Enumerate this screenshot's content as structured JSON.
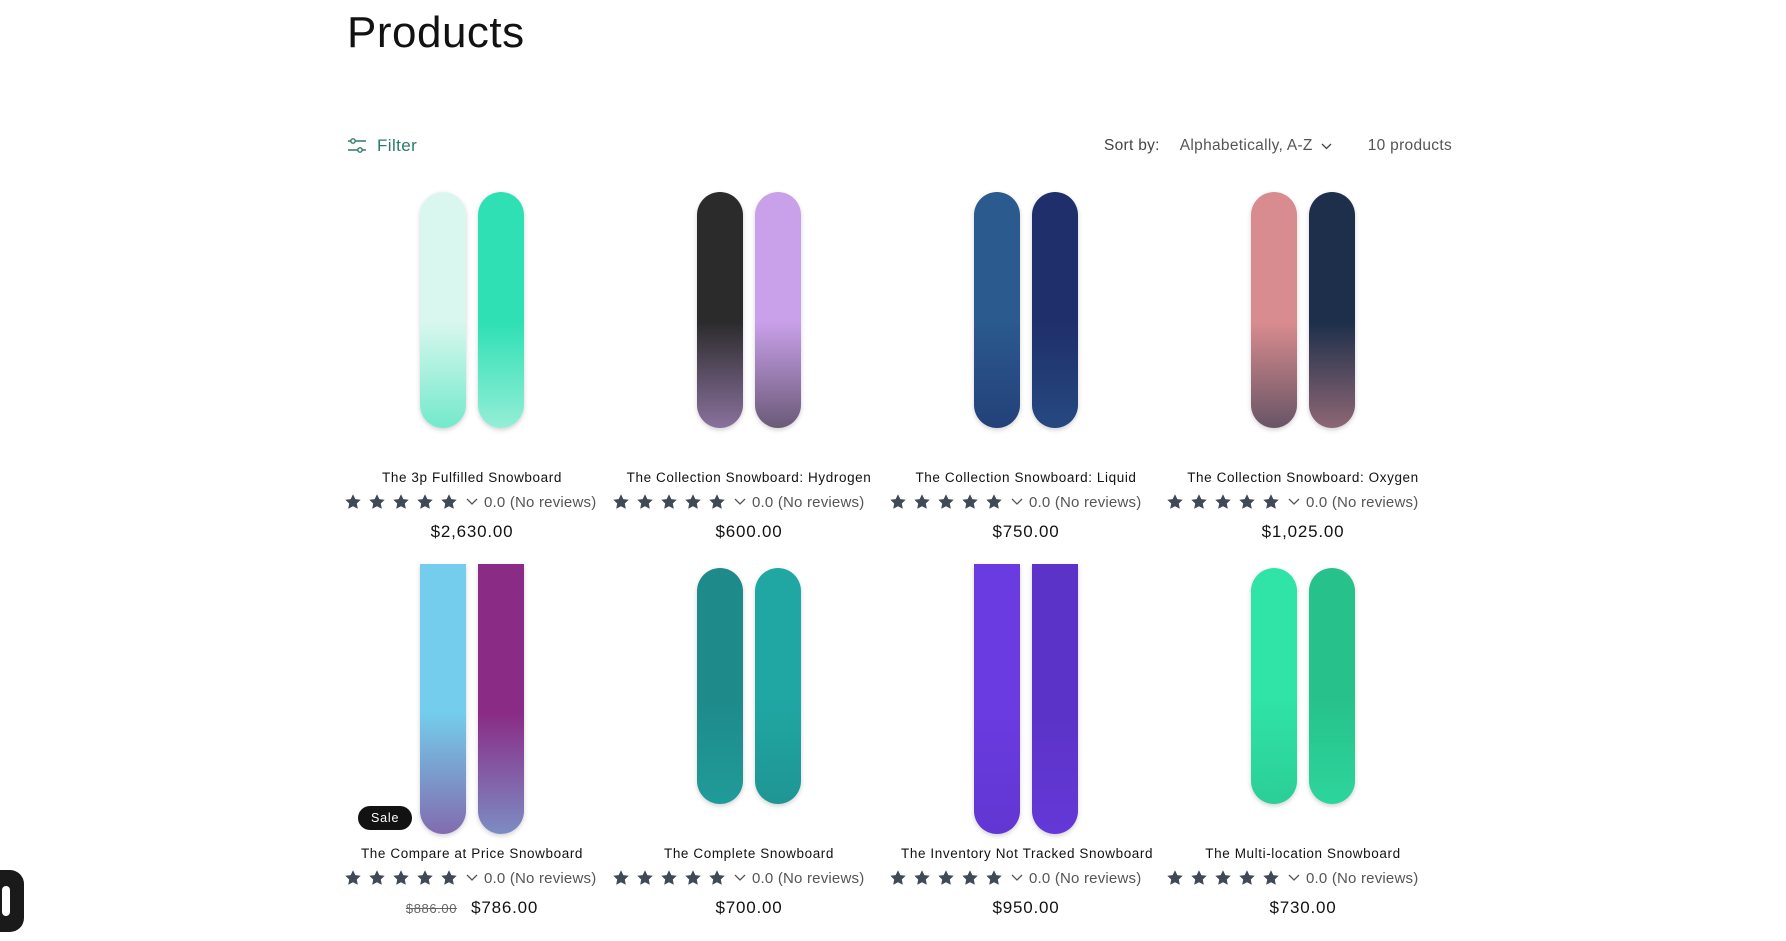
{
  "page": {
    "title": "Products"
  },
  "toolbar": {
    "filter_label": "Filter",
    "sort_label": "Sort by:",
    "sort_value": "Alphabetically, A-Z",
    "product_count": "10 products"
  },
  "products": [
    {
      "title": "The 3p Fulfilled Snowboard",
      "rating": "0.0 (No reviews)",
      "price": "$2,630.00",
      "compare_price": "",
      "badge": "",
      "colors": [
        "#d9f7ee",
        "#2ee0b4"
      ]
    },
    {
      "title": "The Collection Snowboard: Hydrogen",
      "rating": "0.0 (No reviews)",
      "price": "$600.00",
      "compare_price": "",
      "badge": "",
      "colors": [
        "#2b2b2b",
        "#c9a0ea"
      ]
    },
    {
      "title": "The Collection Snowboard: Liquid",
      "rating": "0.0 (No reviews)",
      "price": "$750.00",
      "compare_price": "",
      "badge": "",
      "colors": [
        "#2a5a8e",
        "#1f2f6b"
      ]
    },
    {
      "title": "The Collection Snowboard: Oxygen",
      "rating": "0.0 (No reviews)",
      "price": "$1,025.00",
      "compare_price": "",
      "badge": "",
      "colors": [
        "#d98c8f",
        "#1d2f4a"
      ]
    },
    {
      "title": "The Compare at Price Snowboard",
      "rating": "0.0 (No reviews)",
      "price": "$786.00",
      "compare_price": "$886.00",
      "badge": "Sale",
      "colors": [
        "#74cdec",
        "#8a2b86"
      ]
    },
    {
      "title": "The Complete Snowboard",
      "rating": "0.0 (No reviews)",
      "price": "$700.00",
      "compare_price": "",
      "badge": "",
      "colors": [
        "#1e8a8a",
        "#20a7a3"
      ]
    },
    {
      "title": "The Inventory Not Tracked Snowboard",
      "rating": "0.0 (No reviews)",
      "price": "$950.00",
      "compare_price": "",
      "badge": "",
      "colors": [
        "#6a3be0",
        "#5b33c8"
      ]
    },
    {
      "title": "The Multi-location Snowboard",
      "rating": "0.0 (No reviews)",
      "price": "$730.00",
      "compare_price": "",
      "badge": "",
      "colors": [
        "#30e3a6",
        "#27c18c"
      ]
    }
  ],
  "theme": {
    "accent": "#2c7a6b",
    "star_color": "#3f4a56",
    "badge_bg": "#121212"
  },
  "icons": {
    "filter": "sliders-icon",
    "sort": "chevron-down-icon",
    "star": "star-icon",
    "chat": "chat-icon"
  }
}
